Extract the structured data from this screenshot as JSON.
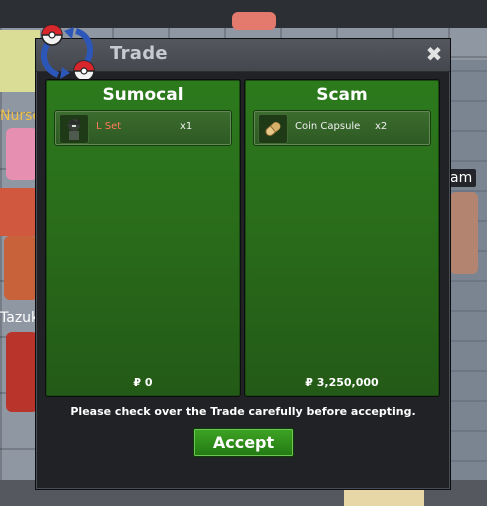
{
  "world": {
    "npc_labels": {
      "nurse": "Nurse",
      "tazu": "Tazuk",
      "am": "am"
    }
  },
  "window": {
    "title": "Trade",
    "close_glyph": "✖",
    "icon": "trade-arrows-icon"
  },
  "left_panel": {
    "player_name": "Sumocal",
    "items": [
      {
        "name": "L Set",
        "qty": "x1",
        "icon": "outfit-icon",
        "name_color": "#ff7a55"
      }
    ],
    "money": "₽ 0"
  },
  "right_panel": {
    "player_name": "Scam",
    "items": [
      {
        "name": "Coin Capsule",
        "qty": "x2",
        "icon": "capsule-icon",
        "name_color": "#f0f0f0"
      }
    ],
    "money": "₽ 3,250,000"
  },
  "notice": "Please check over the Trade carefully before accepting.",
  "accept_label": "Accept",
  "colors": {
    "panel_green": "#2c7a1c",
    "accept_green": "#3da323",
    "window_bg": "#202226"
  }
}
